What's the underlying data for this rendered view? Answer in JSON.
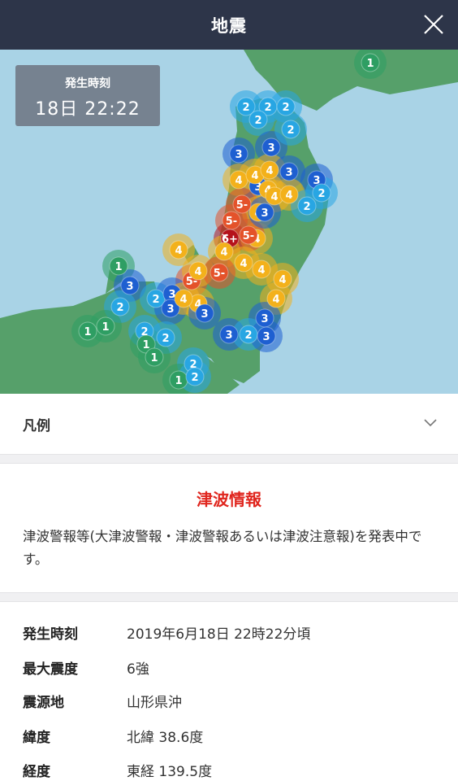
{
  "header": {
    "title": "地震"
  },
  "map": {
    "time_box": {
      "label": "発生時刻",
      "value": "18日 22:22"
    },
    "colors": {
      "sea": "#a9d3e6",
      "land": "#56a06a",
      "intensity_1": "#2e9e63",
      "intensity_2": "#28a6e3",
      "intensity_3": "#1e5fd1",
      "intensity_4": "#f3b11b",
      "intensity_5lower": "#e4522a",
      "intensity_6upper": "#b5121b"
    },
    "markers": [
      {
        "label": "1",
        "level": "1"
      },
      {
        "label": "2",
        "level": "2"
      },
      {
        "label": "2",
        "level": "2"
      },
      {
        "label": "2",
        "level": "2"
      },
      {
        "label": "2",
        "level": "2"
      },
      {
        "label": "3",
        "level": "3"
      },
      {
        "label": "3",
        "level": "3"
      },
      {
        "label": "2",
        "level": "2"
      },
      {
        "label": "3",
        "level": "3"
      },
      {
        "label": "4",
        "level": "4"
      },
      {
        "label": "4",
        "level": "4"
      },
      {
        "label": "4",
        "level": "4"
      },
      {
        "label": "3",
        "level": "3"
      },
      {
        "label": "4",
        "level": "4"
      },
      {
        "label": "5-",
        "level": "5-"
      },
      {
        "label": "4",
        "level": "4"
      },
      {
        "label": "4",
        "level": "4"
      },
      {
        "label": "3",
        "level": "3"
      },
      {
        "label": "4",
        "level": "4"
      },
      {
        "label": "5-",
        "level": "5-"
      },
      {
        "label": "6+",
        "level": "6+"
      },
      {
        "label": "4",
        "level": "4"
      },
      {
        "label": "5-",
        "level": "5-"
      },
      {
        "label": "4",
        "level": "4"
      },
      {
        "label": "4",
        "level": "4"
      },
      {
        "label": "4",
        "level": "4"
      },
      {
        "label": "4",
        "level": "4"
      },
      {
        "label": "5-",
        "level": "5-"
      },
      {
        "label": "4",
        "level": "4"
      },
      {
        "label": "5-",
        "level": "5-"
      },
      {
        "label": "4",
        "level": "4"
      },
      {
        "label": "4",
        "level": "4"
      },
      {
        "label": "4",
        "level": "4"
      },
      {
        "label": "1",
        "level": "1"
      },
      {
        "label": "3",
        "level": "3"
      },
      {
        "label": "2",
        "level": "2"
      },
      {
        "label": "2",
        "level": "2"
      },
      {
        "label": "3",
        "level": "3"
      },
      {
        "label": "3",
        "level": "3"
      },
      {
        "label": "4",
        "level": "4"
      },
      {
        "label": "3",
        "level": "3"
      },
      {
        "label": "3",
        "level": "3"
      },
      {
        "label": "1",
        "level": "1"
      },
      {
        "label": "1",
        "level": "1"
      },
      {
        "label": "2",
        "level": "2"
      },
      {
        "label": "3",
        "level": "3"
      },
      {
        "label": "2",
        "level": "2"
      },
      {
        "label": "3",
        "level": "3"
      },
      {
        "label": "1",
        "level": "1"
      },
      {
        "label": "2",
        "level": "2"
      },
      {
        "label": "2",
        "level": "2"
      },
      {
        "label": "1",
        "level": "1"
      },
      {
        "label": "1",
        "level": "1"
      },
      {
        "label": "2",
        "level": "2"
      },
      {
        "label": "3",
        "level": "3"
      },
      {
        "label": "2",
        "level": "2"
      },
      {
        "label": "2",
        "level": "2"
      }
    ]
  },
  "legend": {
    "label": "凡例"
  },
  "tsunami": {
    "title": "津波情報",
    "text": "津波警報等(大津波警報・津波警報あるいは津波注意報)を発表中です。"
  },
  "details": [
    {
      "key": "発生時刻",
      "value": "2019年6月18日 22時22分頃"
    },
    {
      "key": "最大震度",
      "value": "6強"
    },
    {
      "key": "震源地",
      "value": "山形県沖"
    },
    {
      "key": "緯度",
      "value": "北緯 38.6度"
    },
    {
      "key": "経度",
      "value": "東経 139.5度"
    }
  ]
}
